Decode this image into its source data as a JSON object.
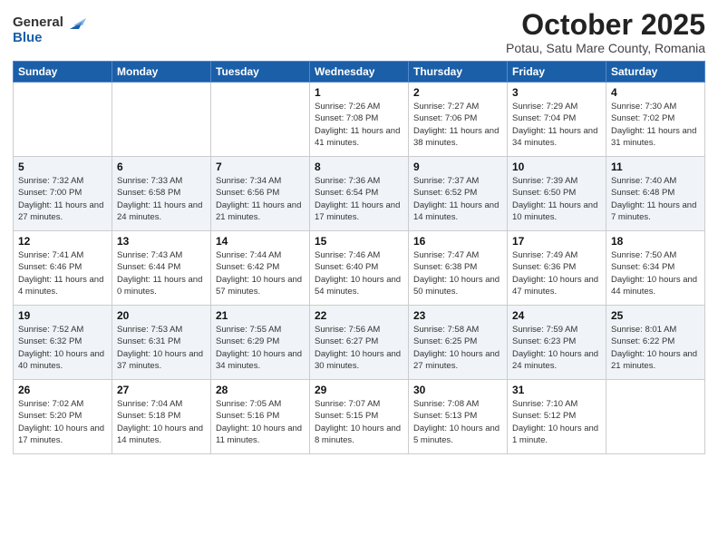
{
  "header": {
    "logo_line1": "General",
    "logo_line2": "Blue",
    "month": "October 2025",
    "location": "Potau, Satu Mare County, Romania"
  },
  "days_of_week": [
    "Sunday",
    "Monday",
    "Tuesday",
    "Wednesday",
    "Thursday",
    "Friday",
    "Saturday"
  ],
  "weeks": [
    [
      {
        "day": "",
        "text": ""
      },
      {
        "day": "",
        "text": ""
      },
      {
        "day": "",
        "text": ""
      },
      {
        "day": "1",
        "text": "Sunrise: 7:26 AM\nSunset: 7:08 PM\nDaylight: 11 hours\nand 41 minutes."
      },
      {
        "day": "2",
        "text": "Sunrise: 7:27 AM\nSunset: 7:06 PM\nDaylight: 11 hours\nand 38 minutes."
      },
      {
        "day": "3",
        "text": "Sunrise: 7:29 AM\nSunset: 7:04 PM\nDaylight: 11 hours\nand 34 minutes."
      },
      {
        "day": "4",
        "text": "Sunrise: 7:30 AM\nSunset: 7:02 PM\nDaylight: 11 hours\nand 31 minutes."
      }
    ],
    [
      {
        "day": "5",
        "text": "Sunrise: 7:32 AM\nSunset: 7:00 PM\nDaylight: 11 hours\nand 27 minutes."
      },
      {
        "day": "6",
        "text": "Sunrise: 7:33 AM\nSunset: 6:58 PM\nDaylight: 11 hours\nand 24 minutes."
      },
      {
        "day": "7",
        "text": "Sunrise: 7:34 AM\nSunset: 6:56 PM\nDaylight: 11 hours\nand 21 minutes."
      },
      {
        "day": "8",
        "text": "Sunrise: 7:36 AM\nSunset: 6:54 PM\nDaylight: 11 hours\nand 17 minutes."
      },
      {
        "day": "9",
        "text": "Sunrise: 7:37 AM\nSunset: 6:52 PM\nDaylight: 11 hours\nand 14 minutes."
      },
      {
        "day": "10",
        "text": "Sunrise: 7:39 AM\nSunset: 6:50 PM\nDaylight: 11 hours\nand 10 minutes."
      },
      {
        "day": "11",
        "text": "Sunrise: 7:40 AM\nSunset: 6:48 PM\nDaylight: 11 hours\nand 7 minutes."
      }
    ],
    [
      {
        "day": "12",
        "text": "Sunrise: 7:41 AM\nSunset: 6:46 PM\nDaylight: 11 hours\nand 4 minutes."
      },
      {
        "day": "13",
        "text": "Sunrise: 7:43 AM\nSunset: 6:44 PM\nDaylight: 11 hours\nand 0 minutes."
      },
      {
        "day": "14",
        "text": "Sunrise: 7:44 AM\nSunset: 6:42 PM\nDaylight: 10 hours\nand 57 minutes."
      },
      {
        "day": "15",
        "text": "Sunrise: 7:46 AM\nSunset: 6:40 PM\nDaylight: 10 hours\nand 54 minutes."
      },
      {
        "day": "16",
        "text": "Sunrise: 7:47 AM\nSunset: 6:38 PM\nDaylight: 10 hours\nand 50 minutes."
      },
      {
        "day": "17",
        "text": "Sunrise: 7:49 AM\nSunset: 6:36 PM\nDaylight: 10 hours\nand 47 minutes."
      },
      {
        "day": "18",
        "text": "Sunrise: 7:50 AM\nSunset: 6:34 PM\nDaylight: 10 hours\nand 44 minutes."
      }
    ],
    [
      {
        "day": "19",
        "text": "Sunrise: 7:52 AM\nSunset: 6:32 PM\nDaylight: 10 hours\nand 40 minutes."
      },
      {
        "day": "20",
        "text": "Sunrise: 7:53 AM\nSunset: 6:31 PM\nDaylight: 10 hours\nand 37 minutes."
      },
      {
        "day": "21",
        "text": "Sunrise: 7:55 AM\nSunset: 6:29 PM\nDaylight: 10 hours\nand 34 minutes."
      },
      {
        "day": "22",
        "text": "Sunrise: 7:56 AM\nSunset: 6:27 PM\nDaylight: 10 hours\nand 30 minutes."
      },
      {
        "day": "23",
        "text": "Sunrise: 7:58 AM\nSunset: 6:25 PM\nDaylight: 10 hours\nand 27 minutes."
      },
      {
        "day": "24",
        "text": "Sunrise: 7:59 AM\nSunset: 6:23 PM\nDaylight: 10 hours\nand 24 minutes."
      },
      {
        "day": "25",
        "text": "Sunrise: 8:01 AM\nSunset: 6:22 PM\nDaylight: 10 hours\nand 21 minutes."
      }
    ],
    [
      {
        "day": "26",
        "text": "Sunrise: 7:02 AM\nSunset: 5:20 PM\nDaylight: 10 hours\nand 17 minutes."
      },
      {
        "day": "27",
        "text": "Sunrise: 7:04 AM\nSunset: 5:18 PM\nDaylight: 10 hours\nand 14 minutes."
      },
      {
        "day": "28",
        "text": "Sunrise: 7:05 AM\nSunset: 5:16 PM\nDaylight: 10 hours\nand 11 minutes."
      },
      {
        "day": "29",
        "text": "Sunrise: 7:07 AM\nSunset: 5:15 PM\nDaylight: 10 hours\nand 8 minutes."
      },
      {
        "day": "30",
        "text": "Sunrise: 7:08 AM\nSunset: 5:13 PM\nDaylight: 10 hours\nand 5 minutes."
      },
      {
        "day": "31",
        "text": "Sunrise: 7:10 AM\nSunset: 5:12 PM\nDaylight: 10 hours\nand 1 minute."
      },
      {
        "day": "",
        "text": ""
      }
    ]
  ]
}
